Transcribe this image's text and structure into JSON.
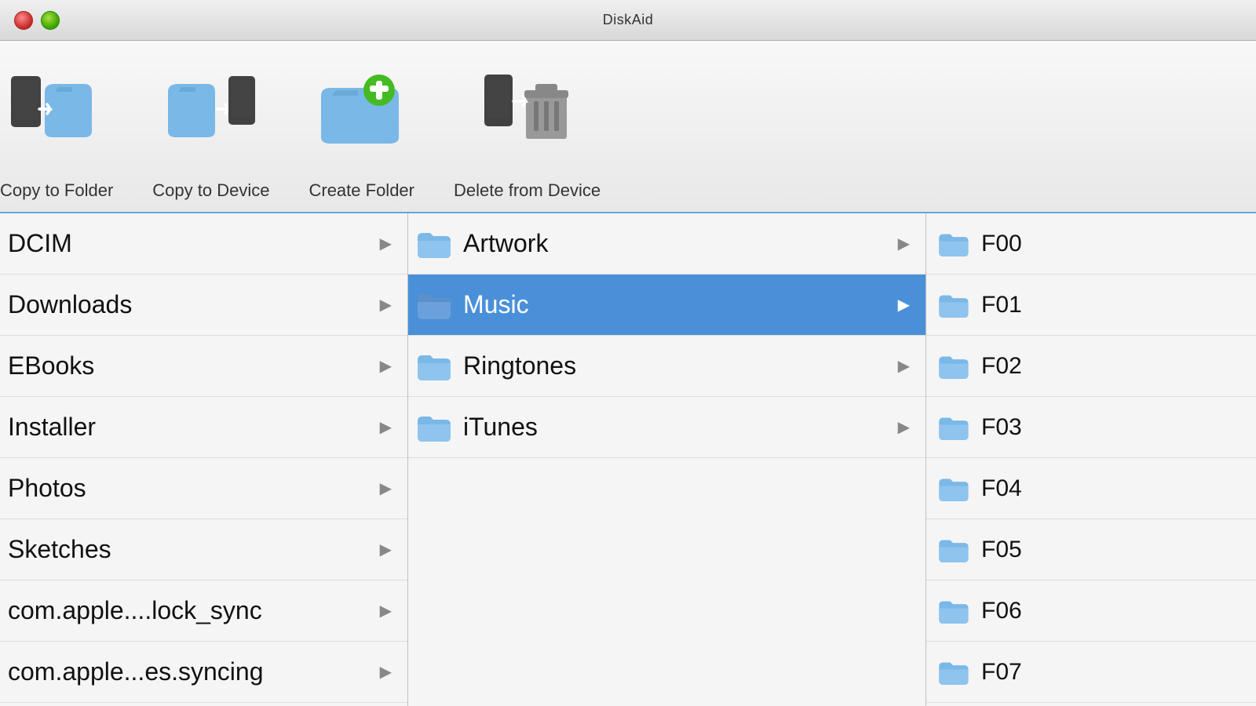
{
  "window": {
    "title": "DiskAid"
  },
  "toolbar": {
    "items": [
      {
        "id": "copy-to-folder",
        "label": "Copy to Folder"
      },
      {
        "id": "copy-to-device",
        "label": "Copy to Device"
      },
      {
        "id": "create-folder",
        "label": "Create Folder"
      },
      {
        "id": "delete-from-device",
        "label": "Delete from Device"
      }
    ]
  },
  "left_panel": {
    "items": [
      {
        "id": "dcim",
        "label": "DCIM",
        "selected": false
      },
      {
        "id": "downloads",
        "label": "Downloads",
        "selected": false
      },
      {
        "id": "ebooks",
        "label": "EBooks",
        "selected": false
      },
      {
        "id": "installer",
        "label": "Installer",
        "selected": false
      },
      {
        "id": "photos",
        "label": "Photos",
        "selected": false
      },
      {
        "id": "sketches",
        "label": "Sketches",
        "selected": false
      },
      {
        "id": "com-apple-lock-sync",
        "label": "com.apple....lock_sync",
        "selected": false
      },
      {
        "id": "com-apple-es-syncing",
        "label": "com.apple...es.syncing",
        "selected": false
      }
    ]
  },
  "middle_panel": {
    "items": [
      {
        "id": "artwork",
        "label": "Artwork",
        "selected": false
      },
      {
        "id": "music",
        "label": "Music",
        "selected": true
      },
      {
        "id": "ringtones",
        "label": "Ringtones",
        "selected": false
      },
      {
        "id": "itunes",
        "label": "iTunes",
        "selected": false
      }
    ]
  },
  "right_panel": {
    "items": [
      {
        "id": "f00",
        "label": "F00"
      },
      {
        "id": "f01",
        "label": "F01"
      },
      {
        "id": "f02",
        "label": "F02"
      },
      {
        "id": "f03",
        "label": "F03"
      },
      {
        "id": "f04",
        "label": "F04"
      },
      {
        "id": "f05",
        "label": "F05"
      },
      {
        "id": "f06",
        "label": "F06"
      },
      {
        "id": "f07",
        "label": "F07"
      }
    ]
  }
}
